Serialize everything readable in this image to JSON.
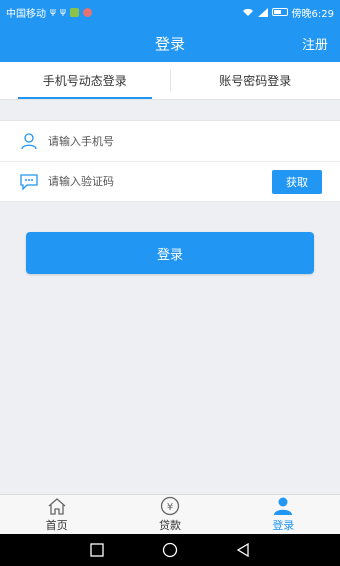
{
  "status_bar": {
    "carrier": "中国移动",
    "time_label": "傍晚6:29",
    "battery_level": 0.7
  },
  "header": {
    "title": "登录",
    "register_label": "注册"
  },
  "tabs": [
    {
      "label": "手机号动态登录",
      "active": true
    },
    {
      "label": "账号密码登录",
      "active": false
    }
  ],
  "form": {
    "phone_placeholder": "请输入手机号",
    "code_placeholder": "请输入验证码",
    "get_code_label": "获取"
  },
  "login_button_label": "登录",
  "tabbar": [
    {
      "label": "首页",
      "icon": "home-icon",
      "active": false
    },
    {
      "label": "贷款",
      "icon": "yuan-icon",
      "active": false
    },
    {
      "label": "登录",
      "icon": "user-icon",
      "active": true
    }
  ],
  "colors": {
    "accent": "#2196f3",
    "background": "#eeeff3"
  }
}
